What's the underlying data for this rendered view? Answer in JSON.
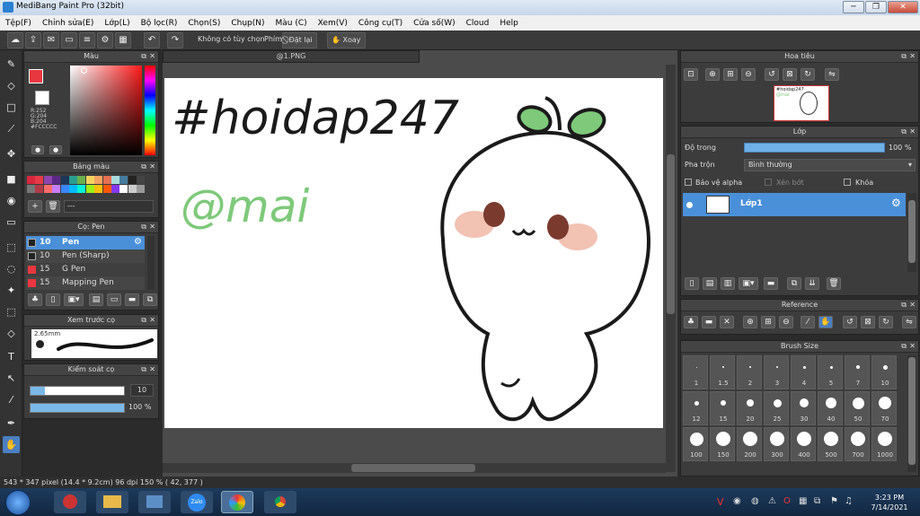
{
  "window": {
    "title": "MediBang Paint Pro (32bit)"
  },
  "menu": [
    "Tệp(F)",
    "Chỉnh sửa(E)",
    "Lớp(L)",
    "Bộ lọc(R)",
    "Chọn(S)",
    "Chụp(N)",
    "Màu (C)",
    "Xem(V)",
    "Công cụ(T)",
    "Cửa số(W)",
    "Cloud",
    "Help"
  ],
  "toolbar": {
    "no_option": "Không có tùy chọn",
    "key_label": "Phím",
    "reset": "Đặt lại",
    "rotate": "Xoay"
  },
  "color_panel": {
    "title": "Màu",
    "r": "R:252",
    "g": "G:204",
    "b": "B:204",
    "hex": "#FCCCCC",
    "main_color": "#e8373f"
  },
  "palette_panel": {
    "title": "Bảng màu",
    "field": "---",
    "swatches": [
      "#d7263d",
      "#e63946",
      "#8e44ad",
      "#5b2a86",
      "#1d3557",
      "#2a9d8f",
      "#6ab04c",
      "#f4d35e",
      "#f4a261",
      "#e76f51",
      "#a8dadc",
      "#457b9d",
      "#222222",
      "#444444",
      "#777777",
      "#b23a48",
      "#ff6b6b",
      "#c77dff",
      "#3a86ff",
      "#00bbf9",
      "#00f5d4",
      "#9ef01a",
      "#ffbe0b",
      "#fb5607",
      "#8338ec",
      "#ffffff",
      "#cccccc",
      "#999999"
    ]
  },
  "brush_panel": {
    "title": "Cọ: Pen",
    "items": [
      {
        "size": "10",
        "name": "Pen",
        "color": "#222222"
      },
      {
        "size": "10",
        "name": "Pen (Sharp)",
        "color": "#222222"
      },
      {
        "size": "15",
        "name": "G Pen",
        "color": "#e8373f"
      },
      {
        "size": "15",
        "name": "Mapping Pen",
        "color": "#e8373f"
      }
    ]
  },
  "preview_panel": {
    "title": "Xem trước cọ",
    "size": "2.65mm"
  },
  "control_panel": {
    "title": "Kiểm soát cọ",
    "size_value": "10",
    "opacity_value": "100 %",
    "size_fraction": 0.15,
    "opacity_fraction": 1.0
  },
  "document": {
    "tab": "@1.PNG",
    "text_hashtag": "#hoidap247",
    "text_mention": "@mai"
  },
  "navigator_panel": {
    "title": "Hoa tiêu",
    "thumb_hashtag": "#hoidap247",
    "thumb_mention": "@mai"
  },
  "layer_panel": {
    "title": "Lớp",
    "opacity_label": "Độ trong",
    "opacity_value": "100 %",
    "blend_label": "Pha trộn",
    "blend_value": "Bình thường",
    "protect_alpha": "Bảo vệ alpha",
    "clipping": "Xén bớt",
    "lock": "Khóa",
    "layer_name": "Lớp1"
  },
  "reference_panel": {
    "title": "Reference"
  },
  "brush_size_panel": {
    "title": "Brush Size",
    "sizes": [
      "1",
      "1.5",
      "2",
      "3",
      "4",
      "5",
      "7",
      "10",
      "12",
      "15",
      "20",
      "25",
      "30",
      "40",
      "50",
      "70",
      "100",
      "150",
      "200",
      "300",
      "400",
      "500",
      "700",
      "1000"
    ]
  },
  "status": {
    "text": "543 * 347 pixel  (14.4 * 9.2cm)  96 dpi  150 %  ( 42, 377 )"
  },
  "taskbar": {
    "time": "3:23 PM",
    "date": "7/14/2021",
    "zalo": "Zalo"
  }
}
